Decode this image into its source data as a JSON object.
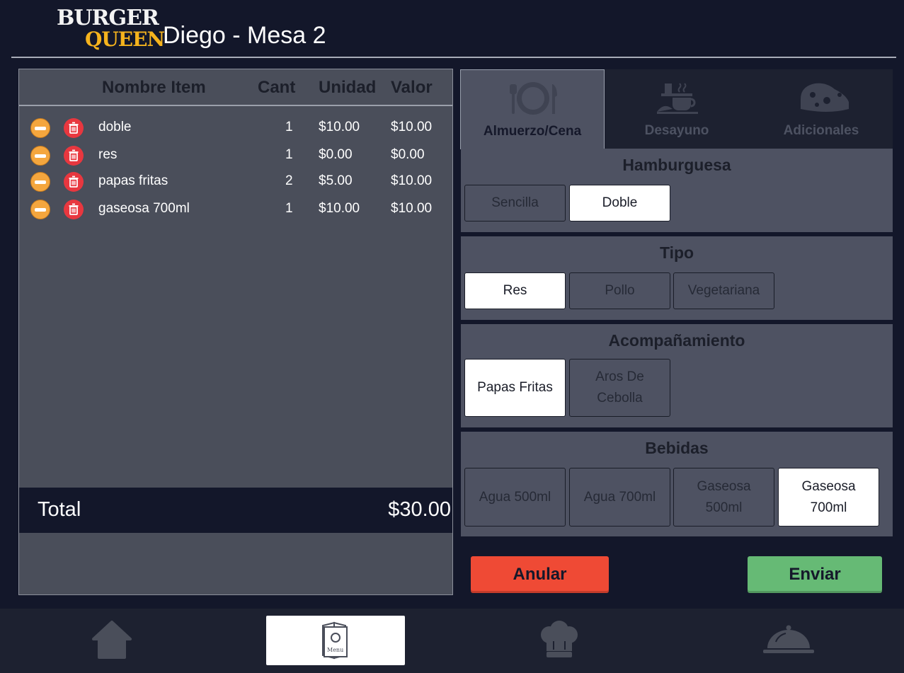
{
  "header": {
    "logo_line1": "BURGER",
    "logo_line2": "QUEEN",
    "title": "Diego - Mesa 2"
  },
  "order": {
    "columns": [
      "Nombre Item",
      "Cant",
      "Unidad",
      "Valor"
    ],
    "items": [
      {
        "name": "doble",
        "qty": "1",
        "unit": "$10.00",
        "value": "$10.00"
      },
      {
        "name": "res",
        "qty": "1",
        "unit": "$0.00",
        "value": "$0.00"
      },
      {
        "name": "papas fritas",
        "qty": "2",
        "unit": "$5.00",
        "value": "$10.00"
      },
      {
        "name": "gaseosa 700ml",
        "qty": "1",
        "unit": "$10.00",
        "value": "$10.00"
      }
    ],
    "total_label": "Total",
    "total_value": "$30.00"
  },
  "tabs": [
    {
      "label": "Almuerzo/Cena",
      "icon": "plate-cutlery-icon",
      "active": true
    },
    {
      "label": "Desayuno",
      "icon": "coffee-breakfast-icon",
      "active": false
    },
    {
      "label": "Adicionales",
      "icon": "cheese-icon",
      "active": false
    }
  ],
  "sections": {
    "hamburguesa": {
      "title": "Hamburguesa",
      "options": [
        {
          "label": "Sencilla",
          "selected": false
        },
        {
          "label": "Doble",
          "selected": true
        }
      ]
    },
    "tipo": {
      "title": "Tipo",
      "options": [
        {
          "label": "Res",
          "selected": true
        },
        {
          "label": "Pollo",
          "selected": false
        },
        {
          "label": "Vegetariana",
          "selected": false
        }
      ]
    },
    "acompanamiento": {
      "title": "Acompañamiento",
      "options": [
        {
          "label": "Papas Fritas",
          "selected": true
        },
        {
          "label": "Aros De Cebolla",
          "selected": false
        }
      ]
    },
    "bebidas": {
      "title": "Bebidas",
      "options": [
        {
          "label": "Agua 500ml",
          "selected": false
        },
        {
          "label": "Agua 700ml",
          "selected": false
        },
        {
          "label": "Gaseosa 500ml",
          "selected": false
        },
        {
          "label": "Gaseosa 700ml",
          "selected": true
        }
      ]
    }
  },
  "actions": {
    "cancel": "Anular",
    "send": "Enviar"
  },
  "nav": [
    {
      "icon": "home-icon",
      "active": false
    },
    {
      "icon": "menu-icon",
      "label": "Menu",
      "active": true
    },
    {
      "icon": "chef-hat-icon",
      "active": false
    },
    {
      "icon": "serving-cloche-icon",
      "active": false
    }
  ],
  "colors": {
    "background": "#13172a",
    "panel": "#4a4e5a",
    "accent_yellow": "#f5b31d",
    "cancel": "#ef4a35",
    "send": "#66ba75",
    "minus": "#f4a63e",
    "trash": "#e8373f"
  }
}
